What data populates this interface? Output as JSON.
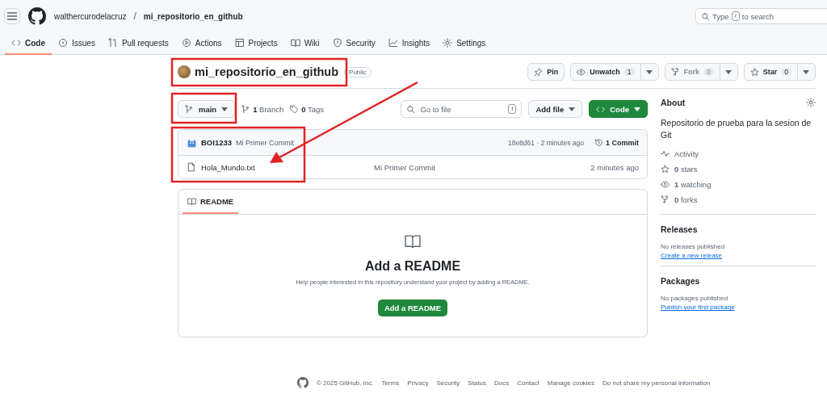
{
  "header": {
    "owner": "walthercurodelacruz",
    "separator": "/",
    "repo": "mi_repositorio_en_github",
    "search": {
      "before": "Type",
      "key": "/",
      "after": "to search"
    }
  },
  "nav_tabs": [
    {
      "label": "Code",
      "selected": true
    },
    {
      "label": "Issues",
      "selected": false
    },
    {
      "label": "Pull requests",
      "selected": false
    },
    {
      "label": "Actions",
      "selected": false
    },
    {
      "label": "Projects",
      "selected": false
    },
    {
      "label": "Wiki",
      "selected": false
    },
    {
      "label": "Security",
      "selected": false
    },
    {
      "label": "Insights",
      "selected": false
    },
    {
      "label": "Settings",
      "selected": false
    }
  ],
  "repo": {
    "name": "mi_repositorio_en_github",
    "visibility": "Public"
  },
  "repo_actions": [
    {
      "label": "Pin",
      "disabled": false
    },
    {
      "label": "Unwatch",
      "count": "1",
      "disabled": false
    },
    {
      "label": "Fork",
      "count": "0",
      "disabled": true
    },
    {
      "label": "Star",
      "count": "0",
      "disabled": false
    }
  ],
  "branch_bar": {
    "branch": "main",
    "branches": "**1** Branch",
    "tags": "**0** Tags",
    "file_search": {
      "placeholder": "Go to file",
      "key": "t"
    },
    "add_file": "Add file",
    "code": "Code"
  },
  "commit": {
    "author": "BOI1233",
    "message": "Mi Primer Commit",
    "meta": "18e8d61 · 2 minutes ago",
    "commits": "1 Commit"
  },
  "files": [
    {
      "name": "Hola_Mundo.txt",
      "message": "Mi Primer Commit",
      "time": "2 minutes ago"
    }
  ],
  "readme": {
    "tab": "README",
    "heading": "Add a README",
    "text": "Help people interested in this repository understand your project by adding a README.",
    "button": "Add a README"
  },
  "about": {
    "title": "About",
    "description": "Repositorio de prueba para la sesion de Git",
    "stats": [
      {
        "label": "Activity"
      },
      {
        "label": "**0** stars"
      },
      {
        "label": "**1** watching"
      },
      {
        "label": "**0** forks"
      }
    ]
  },
  "releases": {
    "title": "Releases",
    "note": "No releases published",
    "link": "Create a new release"
  },
  "packages": {
    "title": "Packages",
    "note": "No packages published",
    "link": "Publish your first package"
  },
  "footer": {
    "copyright": "© 2025 GitHub, Inc.",
    "links": [
      "Terms",
      "Privacy",
      "Security",
      "Status",
      "Docs",
      "Contact",
      "Manage cookies",
      "Do not share my personal information"
    ]
  }
}
